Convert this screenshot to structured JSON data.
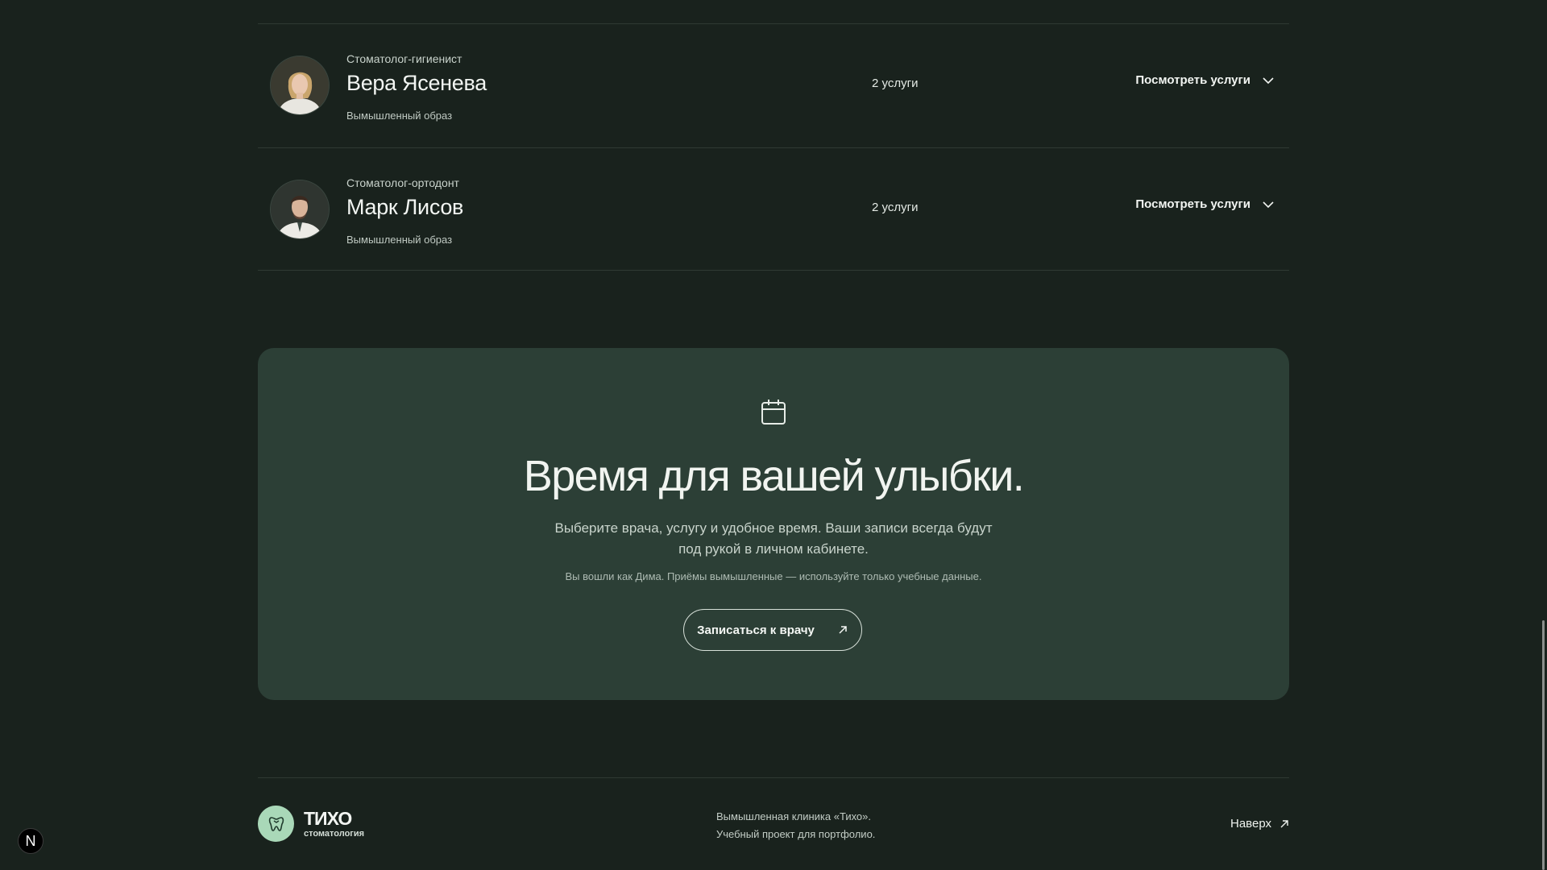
{
  "doctors": [
    {
      "role": "Стоматолог-гигиенист",
      "name": "Вера Ясенева",
      "note": "Вымышленный образ",
      "services_count": "2 услуги",
      "toggle_label": "Посмотреть услуги"
    },
    {
      "role": "Стоматолог-ортодонт",
      "name": "Марк Лисов",
      "note": "Вымышленный образ",
      "services_count": "2 услуги",
      "toggle_label": "Посмотреть услуги"
    }
  ],
  "cta": {
    "icon": "calendar-icon",
    "title": "Время для вашей улыбки.",
    "text": "Выберите врача, услугу и удобное время. Ваши записи всегда будут под рукой в личном кабинете.",
    "note": "Вы вошли как Дима. Приёмы вымышленные — используйте только учебные данные.",
    "button_label": "Записаться к врачу"
  },
  "footer": {
    "brand_name": "ТИХО",
    "brand_sub": "стоматология",
    "info_line1": "Вымышленная клиника «Тихо».",
    "info_line2": "Учебный проект для портфолио.",
    "to_top_label": "Наверх"
  },
  "dev_badge": "N",
  "colors": {
    "background": "#19221d",
    "card": "#2c3f36",
    "logo_badge": "#a9d8b8"
  }
}
